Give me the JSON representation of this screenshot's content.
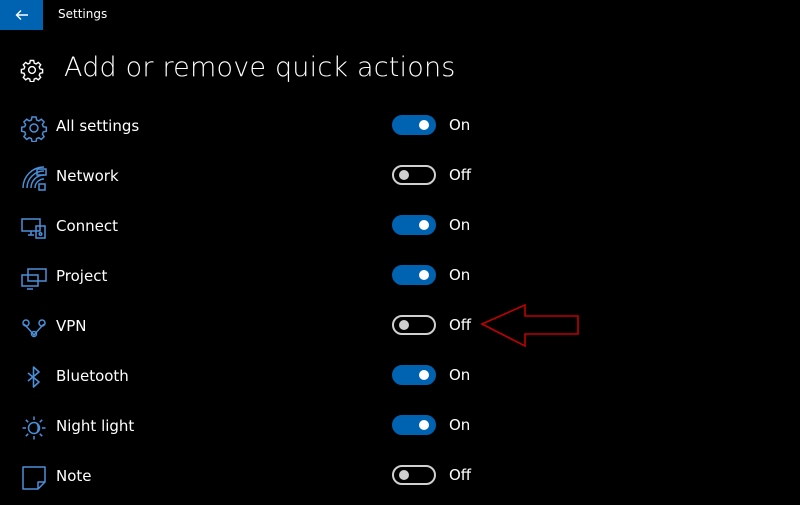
{
  "window": {
    "title": "Settings"
  },
  "page": {
    "title": "Add or remove quick actions"
  },
  "actions": [
    {
      "label": "All settings",
      "state": "On",
      "on": true
    },
    {
      "label": "Network",
      "state": "Off",
      "on": false
    },
    {
      "label": "Connect",
      "state": "On",
      "on": true
    },
    {
      "label": "Project",
      "state": "On",
      "on": true
    },
    {
      "label": "VPN",
      "state": "Off",
      "on": false
    },
    {
      "label": "Bluetooth",
      "state": "On",
      "on": true
    },
    {
      "label": "Night light",
      "state": "On",
      "on": true
    },
    {
      "label": "Note",
      "state": "Off",
      "on": false
    }
  ],
  "icons": [
    "gear-icon",
    "network-icon",
    "connect-icon",
    "project-icon",
    "vpn-icon",
    "bluetooth-icon",
    "night-light-icon",
    "note-icon"
  ],
  "colors": {
    "accent": "#0063b1",
    "arrow": "#c00000",
    "background": "#000000"
  }
}
